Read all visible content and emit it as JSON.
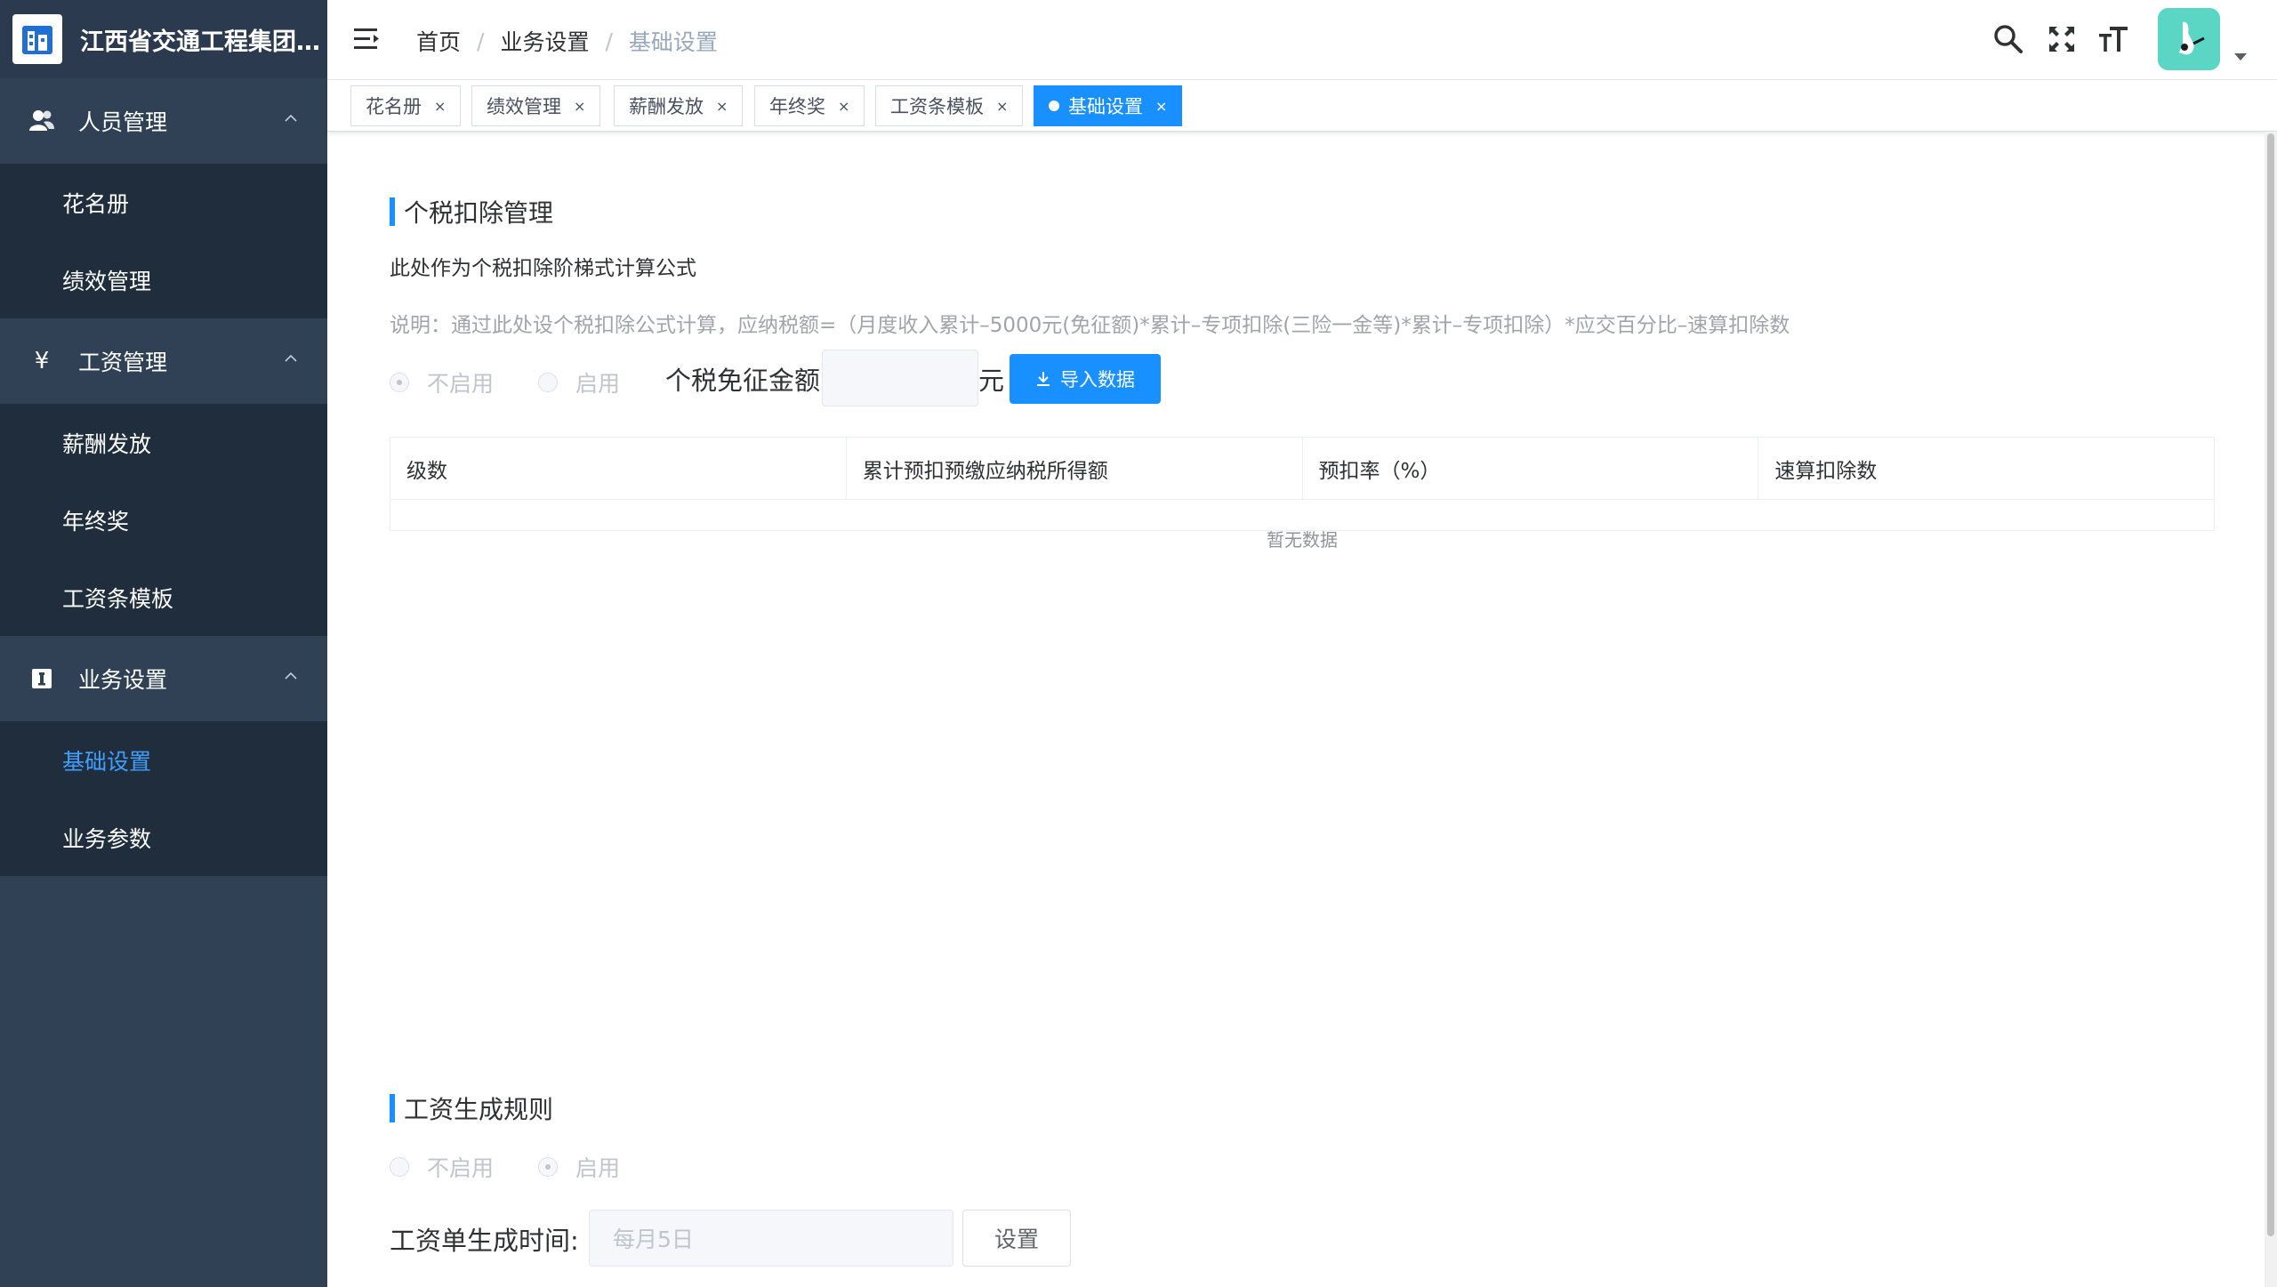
{
  "app": {
    "title": "江西省交通工程集团..."
  },
  "sidebar": {
    "groups": [
      {
        "label": "人员管理",
        "icon": "user-group-icon",
        "items": [
          {
            "label": "花名册"
          },
          {
            "label": "绩效管理"
          }
        ]
      },
      {
        "label": "工资管理",
        "icon": "yen-icon",
        "items": [
          {
            "label": "薪酬发放"
          },
          {
            "label": "年终奖"
          },
          {
            "label": "工资条模板"
          }
        ]
      },
      {
        "label": "业务设置",
        "icon": "info-box-icon",
        "items": [
          {
            "label": "基础设置",
            "active": true
          },
          {
            "label": "业务参数"
          }
        ]
      }
    ]
  },
  "header": {
    "breadcrumb": [
      "首页",
      "业务设置",
      "基础设置"
    ],
    "breadcrumb_sep": "/",
    "icons": [
      "search-icon",
      "fullscreen-icon",
      "font-size-icon"
    ]
  },
  "tags": [
    {
      "label": "花名册",
      "close": "×"
    },
    {
      "label": "绩效管理",
      "close": "×"
    },
    {
      "label": "薪酬发放",
      "close": "×"
    },
    {
      "label": "年终奖",
      "close": "×"
    },
    {
      "label": "工资条模板",
      "close": "×"
    },
    {
      "label": "基础设置",
      "close": "×",
      "active": true
    }
  ],
  "tax": {
    "title": "个税扣除管理",
    "formula_title": "此处作为个税扣除阶梯式计算公式",
    "description": "说明：通过此处设个税扣除公式计算，应纳税额=（月度收入累计–5000元(免征额)*累计–专项扣除(三险一金等)*累计–专项扣除）*应交百分比–速算扣除数",
    "radio_disable": "不启用",
    "radio_enable": "启用",
    "selected": "不启用",
    "exempt_label": "个税免征金额",
    "exempt_value": "",
    "unit": "元",
    "import_button": "导入数据",
    "table_headers": [
      "级数",
      "累计预扣预缴应纳税所得额",
      "预扣率（%）",
      "速算扣除数"
    ],
    "empty_text": "暂无数据"
  },
  "salary_rule": {
    "title": "工资生成规则",
    "radio_disable": "不启用",
    "radio_enable": "启用",
    "selected": "启用",
    "time_label": "工资单生成时间:",
    "time_placeholder": "每月5日",
    "set_button": "设置"
  },
  "colors": {
    "sidebar_bg": "#304156",
    "submenu_bg": "#1f2d3d",
    "accent": "#1890ff",
    "active_menu_text": "#409eff"
  }
}
